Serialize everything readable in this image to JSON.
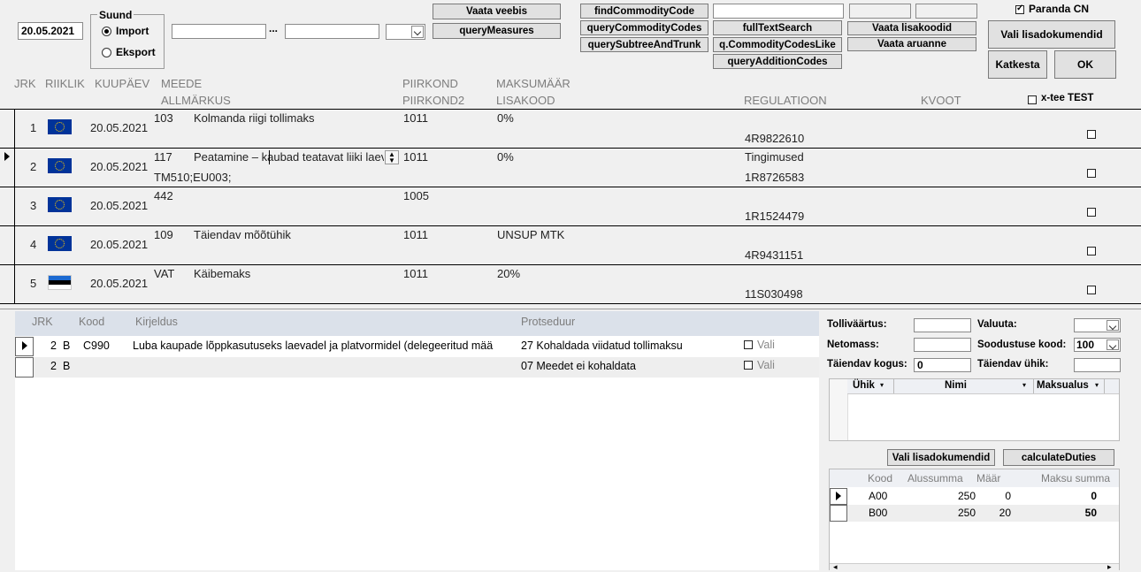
{
  "toolbar": {
    "date_value": "20.05.2021",
    "direction": {
      "title": "Suund",
      "import": "Import",
      "export": "Eksport"
    },
    "range_sep": "...",
    "buttons": {
      "vaata_veebis": "Vaata veebis",
      "query_measures": "queryMeasures",
      "find_commodity_code": "findCommodityCode",
      "query_commodity_codes": "queryCommodityCodes",
      "query_subtree": "querySubtreeAndTrunk",
      "full_text_search": "fullTextSearch",
      "commodity_codes_like": "q.CommodityCodesLike",
      "query_addition_codes": "queryAdditionCodes",
      "vaata_lisakoodid": "Vaata lisakoodid",
      "vaata_aruanne": "Vaata aruanne",
      "vali_lisadokumendid": "Vali lisadokumendid",
      "katkesta": "Katkesta",
      "ok": "OK"
    },
    "paranda_cn": "Paranda CN",
    "xtee_test": "x-tee TEST"
  },
  "measures_header": {
    "jrk": "JRK",
    "riiklik": "RIIKLIK",
    "kuupaev": "KUUPÄEV",
    "meede": "MEEDE",
    "allmarkus": "ALLMÄRKUS",
    "piirkond": "PIIRKOND",
    "piirkond2": "PIIRKOND2",
    "maksumaar": "MAKSUMÄÄR",
    "lisakood": "LISAKOOD",
    "regulatsioon": "REGULATIOON",
    "kvoot": "KVOOT"
  },
  "measures": [
    {
      "jrk": "1",
      "flag": "eu",
      "date": "20.05.2021",
      "code": "103",
      "desc": "Kolmanda riigi tollimaks",
      "area": "1011",
      "rate": "0%",
      "note": "",
      "reg_top": "",
      "reg": "4R9822610"
    },
    {
      "jrk": "2",
      "flag": "eu",
      "date": "20.05.2021",
      "code": "117",
      "desc": "Peatamine – kaubad teatavat liiki laev",
      "area": "1011",
      "rate": "0%",
      "note": "TM510;EU003;",
      "reg_top": "Tingimused",
      "reg": "1R8726583"
    },
    {
      "jrk": "3",
      "flag": "eu",
      "date": "20.05.2021",
      "code": "442",
      "desc": "",
      "area": "1005",
      "rate": "",
      "note": "",
      "reg_top": "",
      "reg": "1R1524479"
    },
    {
      "jrk": "4",
      "flag": "eu",
      "date": "20.05.2021",
      "code": "109",
      "desc": "Täiendav mõõtühik",
      "area": "1011",
      "rate": "UNSUP MTK",
      "note": "",
      "reg_top": "",
      "reg": "4R9431151"
    },
    {
      "jrk": "5",
      "flag": "ee",
      "date": "20.05.2021",
      "code": "VAT",
      "desc": "Käibemaks",
      "area": "1011",
      "rate": "20%",
      "note": "",
      "reg_top": "",
      "reg": "11S030498"
    }
  ],
  "conditions_header": {
    "jrk": "JRK",
    "kood": "Kood",
    "kirjeldus": "Kirjeldus",
    "protseduur": "Protseduur"
  },
  "conditions": [
    {
      "jrk": "2",
      "type": "B",
      "code": "C990",
      "desc": "Luba kaupade lõppkasutuseks laevadel ja platvormidel (delegeeritud mää",
      "proc": "27 Kohaldada viidatud tollimaksu",
      "vali": "Vali"
    },
    {
      "jrk": "2",
      "type": "B",
      "code": "",
      "desc": "",
      "proc": "07 Meedet ei kohaldata",
      "vali": "Vali"
    }
  ],
  "right_form": {
    "tollivaartus": "Tolliväärtus:",
    "valuuta": "Valuuta:",
    "netomass": "Netomass:",
    "soodustuse_kood": "Soodustuse kood:",
    "soodustuse_value": "100",
    "taiendav_kogus": "Täiendav kogus:",
    "taiendav_kogus_value": "0",
    "taiendav_uhik": "Täiendav ühik:"
  },
  "unit_grid": {
    "col1": "Ühik",
    "col2": "Nimi",
    "col3": "Maksualus"
  },
  "duty_buttons": {
    "vali": "Vali lisadokumendid",
    "calc": "calculateDuties"
  },
  "duties_header": {
    "kood": "Kood",
    "alussumma": "Alussumma",
    "maar": "Määr",
    "maksu_summa": "Maksu summa"
  },
  "duties": [
    {
      "kood": "A00",
      "alussumma": "250",
      "maar": "0",
      "summa": "0"
    },
    {
      "kood": "B00",
      "alussumma": "250",
      "maar": "20",
      "summa": "50"
    }
  ]
}
